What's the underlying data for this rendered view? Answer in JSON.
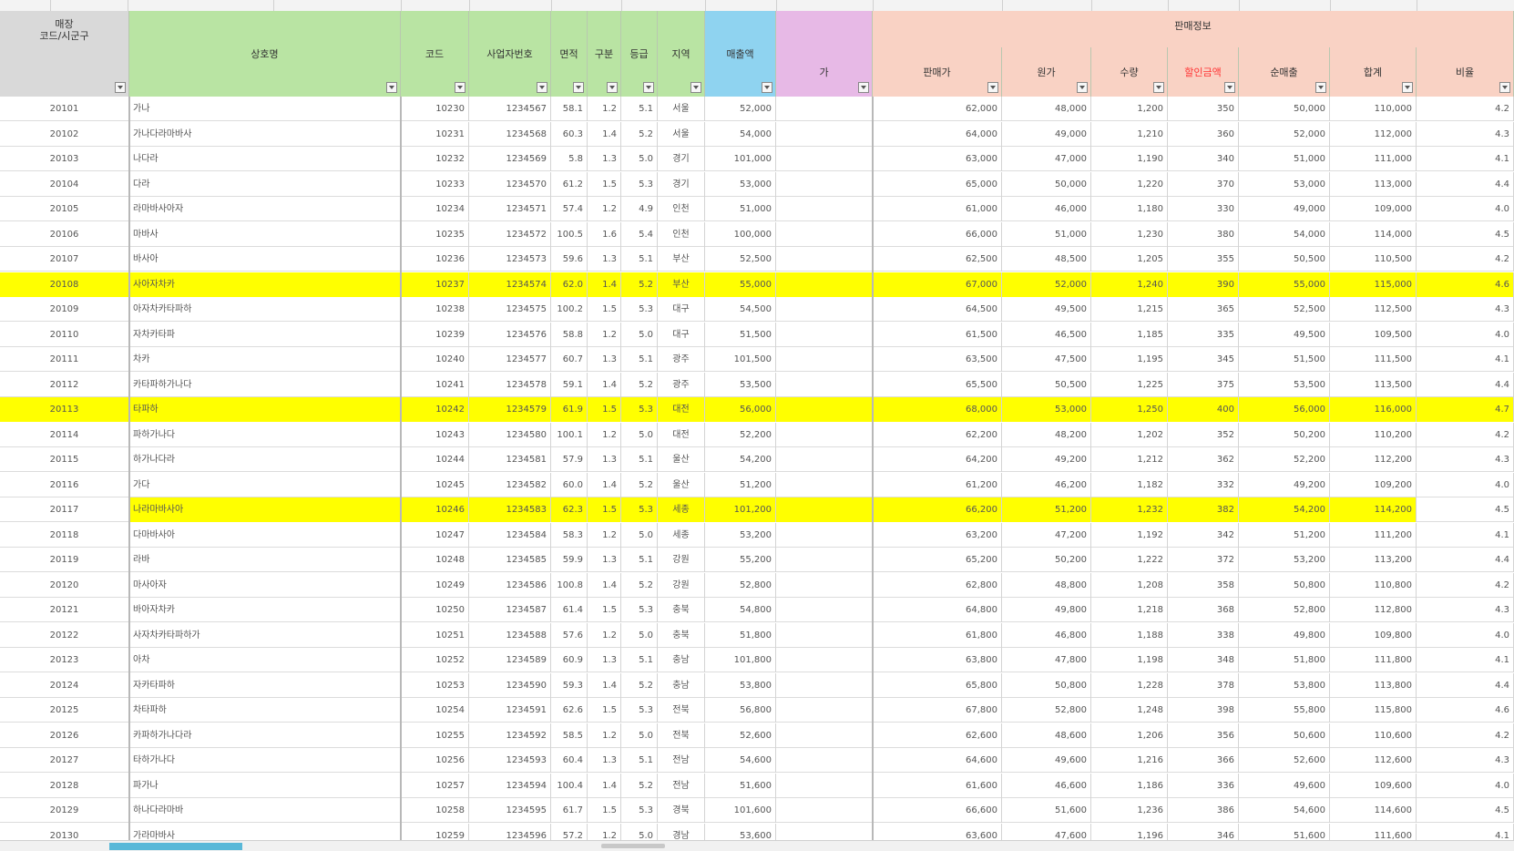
{
  "colors": {
    "green_header": "#b9e4a3",
    "blue_header": "#8fd3f0",
    "pink_header": "#f9d2c4",
    "gray_header": "#d9d9d9",
    "highlight": "#ffff00",
    "red_text": "#ff3333"
  },
  "group_header": {
    "label": "판매정보"
  },
  "columns": [
    {
      "key": "code",
      "label": "매장\n코드/시군구",
      "bg": "gray"
    },
    {
      "key": "name",
      "label": "상호명",
      "bg": "green"
    },
    {
      "key": "c2",
      "label": "코드",
      "bg": "green"
    },
    {
      "key": "c3",
      "label": "사업자번호",
      "bg": "green"
    },
    {
      "key": "c4",
      "label": "면적",
      "bg": "green"
    },
    {
      "key": "c5",
      "label": "구분",
      "bg": "green"
    },
    {
      "key": "c6",
      "label": "등급",
      "bg": "green"
    },
    {
      "key": "c7",
      "label": "지역",
      "bg": "green"
    },
    {
      "key": "c8",
      "label": "매출액",
      "bg": "blue"
    },
    {
      "key": "c9",
      "label": "가",
      "bg": "purple"
    },
    {
      "key": "c10",
      "label": "판매가",
      "bg": "pink"
    },
    {
      "key": "c11",
      "label": "원가",
      "bg": "pink"
    },
    {
      "key": "c12",
      "label": "수량",
      "bg": "pink"
    },
    {
      "key": "c13",
      "label": "할인금액",
      "bg": "pink",
      "red": true
    },
    {
      "key": "c14",
      "label": "순매출",
      "bg": "pink"
    },
    {
      "key": "c15",
      "label": "합계",
      "bg": "pink"
    },
    {
      "key": "c16",
      "label": "비율",
      "bg": "pink"
    }
  ],
  "rows": [
    {
      "cells": [
        "20101",
        "가나",
        "10230",
        "1234567",
        "58.1",
        "1.2",
        "5.1",
        "서울",
        "52,000",
        "",
        "62,000",
        "48,000",
        "1,200",
        "350",
        "50,000",
        "110,000",
        "4.2"
      ]
    },
    {
      "cells": [
        "20102",
        "가나다라마바사",
        "10231",
        "1234568",
        "60.3",
        "1.4",
        "5.2",
        "서울",
        "54,000",
        "",
        "64,000",
        "49,000",
        "1,210",
        "360",
        "52,000",
        "112,000",
        "4.3"
      ]
    },
    {
      "cells": [
        "20103",
        "나다라",
        "10232",
        "1234569",
        "5.8",
        "1.3",
        "5.0",
        "경기",
        "101,000",
        "",
        "63,000",
        "47,000",
        "1,190",
        "340",
        "51,000",
        "111,000",
        "4.1"
      ]
    },
    {
      "cells": [
        "20104",
        "다라",
        "10233",
        "1234570",
        "61.2",
        "1.5",
        "5.3",
        "경기",
        "53,000",
        "",
        "65,000",
        "50,000",
        "1,220",
        "370",
        "53,000",
        "113,000",
        "4.4"
      ]
    },
    {
      "cells": [
        "20105",
        "라마바사아자",
        "10234",
        "1234571",
        "57.4",
        "1.2",
        "4.9",
        "인천",
        "51,000",
        "",
        "61,000",
        "46,000",
        "1,180",
        "330",
        "49,000",
        "109,000",
        "4.0"
      ]
    },
    {
      "cells": [
        "20106",
        "마바사",
        "10235",
        "1234572",
        "100.5",
        "1.6",
        "5.4",
        "인천",
        "100,000",
        "",
        "66,000",
        "51,000",
        "1,230",
        "380",
        "54,000",
        "114,000",
        "4.5"
      ]
    },
    {
      "cells": [
        "20107",
        "바사아",
        "10236",
        "1234573",
        "59.6",
        "1.3",
        "5.1",
        "부산",
        "52,500",
        "",
        "62,500",
        "48,500",
        "1,205",
        "355",
        "50,500",
        "110,500",
        "4.2"
      ]
    },
    {
      "cells": [
        "20108",
        "사아자차카",
        "10237",
        "1234574",
        "62.0",
        "1.4",
        "5.2",
        "부산",
        "55,000",
        "",
        "67,000",
        "52,000",
        "1,240",
        "390",
        "55,000",
        "115,000",
        "4.6"
      ],
      "highlight": "full"
    },
    {
      "cells": [
        "20109",
        "아자차카타파하",
        "10238",
        "1234575",
        "100.2",
        "1.5",
        "5.3",
        "대구",
        "54,500",
        "",
        "64,500",
        "49,500",
        "1,215",
        "365",
        "52,500",
        "112,500",
        "4.3"
      ]
    },
    {
      "cells": [
        "20110",
        "자차카타파",
        "10239",
        "1234576",
        "58.8",
        "1.2",
        "5.0",
        "대구",
        "51,500",
        "",
        "61,500",
        "46,500",
        "1,185",
        "335",
        "49,500",
        "109,500",
        "4.0"
      ]
    },
    {
      "cells": [
        "20111",
        "차카",
        "10240",
        "1234577",
        "60.7",
        "1.3",
        "5.1",
        "광주",
        "101,500",
        "",
        "63,500",
        "47,500",
        "1,195",
        "345",
        "51,500",
        "111,500",
        "4.1"
      ]
    },
    {
      "cells": [
        "20112",
        "카타파하가나다",
        "10241",
        "1234578",
        "59.1",
        "1.4",
        "5.2",
        "광주",
        "53,500",
        "",
        "65,500",
        "50,500",
        "1,225",
        "375",
        "53,500",
        "113,500",
        "4.4"
      ]
    },
    {
      "cells": [
        "20113",
        "타파하",
        "10242",
        "1234579",
        "61.9",
        "1.5",
        "5.3",
        "대전",
        "56,000",
        "",
        "68,000",
        "53,000",
        "1,250",
        "400",
        "56,000",
        "116,000",
        "4.7"
      ],
      "highlight": "full"
    },
    {
      "cells": [
        "20114",
        "파하가나다",
        "10243",
        "1234580",
        "100.1",
        "1.2",
        "5.0",
        "대전",
        "52,200",
        "",
        "62,200",
        "48,200",
        "1,202",
        "352",
        "50,200",
        "110,200",
        "4.2"
      ]
    },
    {
      "cells": [
        "20115",
        "하가나다라",
        "10244",
        "1234581",
        "57.9",
        "1.3",
        "5.1",
        "울산",
        "54,200",
        "",
        "64,200",
        "49,200",
        "1,212",
        "362",
        "52,200",
        "112,200",
        "4.3"
      ]
    },
    {
      "cells": [
        "20116",
        "가다",
        "10245",
        "1234582",
        "60.0",
        "1.4",
        "5.2",
        "울산",
        "51,200",
        "",
        "61,200",
        "46,200",
        "1,182",
        "332",
        "49,200",
        "109,200",
        "4.0"
      ]
    },
    {
      "cells": [
        "20117",
        "나라마바사아",
        "10246",
        "1234583",
        "62.3",
        "1.5",
        "5.3",
        "세종",
        "101,200",
        "",
        "66,200",
        "51,200",
        "1,232",
        "382",
        "54,200",
        "114,200",
        "4.5"
      ],
      "highlight": "partial"
    },
    {
      "cells": [
        "20118",
        "다마바사아",
        "10247",
        "1234584",
        "58.3",
        "1.2",
        "5.0",
        "세종",
        "53,200",
        "",
        "63,200",
        "47,200",
        "1,192",
        "342",
        "51,200",
        "111,200",
        "4.1"
      ]
    },
    {
      "cells": [
        "20119",
        "라바",
        "10248",
        "1234585",
        "59.9",
        "1.3",
        "5.1",
        "강원",
        "55,200",
        "",
        "65,200",
        "50,200",
        "1,222",
        "372",
        "53,200",
        "113,200",
        "4.4"
      ]
    },
    {
      "cells": [
        "20120",
        "마사아자",
        "10249",
        "1234586",
        "100.8",
        "1.4",
        "5.2",
        "강원",
        "52,800",
        "",
        "62,800",
        "48,800",
        "1,208",
        "358",
        "50,800",
        "110,800",
        "4.2"
      ]
    },
    {
      "cells": [
        "20121",
        "바아자차카",
        "10250",
        "1234587",
        "61.4",
        "1.5",
        "5.3",
        "충북",
        "54,800",
        "",
        "64,800",
        "49,800",
        "1,218",
        "368",
        "52,800",
        "112,800",
        "4.3"
      ]
    },
    {
      "cells": [
        "20122",
        "사자차카타파하가",
        "10251",
        "1234588",
        "57.6",
        "1.2",
        "5.0",
        "충북",
        "51,800",
        "",
        "61,800",
        "46,800",
        "1,188",
        "338",
        "49,800",
        "109,800",
        "4.0"
      ]
    },
    {
      "cells": [
        "20123",
        "아차",
        "10252",
        "1234589",
        "60.9",
        "1.3",
        "5.1",
        "충남",
        "101,800",
        "",
        "63,800",
        "47,800",
        "1,198",
        "348",
        "51,800",
        "111,800",
        "4.1"
      ]
    },
    {
      "cells": [
        "20124",
        "자카타파하",
        "10253",
        "1234590",
        "59.3",
        "1.4",
        "5.2",
        "충남",
        "53,800",
        "",
        "65,800",
        "50,800",
        "1,228",
        "378",
        "53,800",
        "113,800",
        "4.4"
      ]
    },
    {
      "cells": [
        "20125",
        "차타파하",
        "10254",
        "1234591",
        "62.6",
        "1.5",
        "5.3",
        "전북",
        "56,800",
        "",
        "67,800",
        "52,800",
        "1,248",
        "398",
        "55,800",
        "115,800",
        "4.6"
      ]
    },
    {
      "cells": [
        "20126",
        "카파하가나다라",
        "10255",
        "1234592",
        "58.5",
        "1.2",
        "5.0",
        "전북",
        "52,600",
        "",
        "62,600",
        "48,600",
        "1,206",
        "356",
        "50,600",
        "110,600",
        "4.2"
      ]
    },
    {
      "cells": [
        "20127",
        "타하가나다",
        "10256",
        "1234593",
        "60.4",
        "1.3",
        "5.1",
        "전남",
        "54,600",
        "",
        "64,600",
        "49,600",
        "1,216",
        "366",
        "52,600",
        "112,600",
        "4.3"
      ]
    },
    {
      "cells": [
        "20128",
        "파가나",
        "10257",
        "1234594",
        "100.4",
        "1.4",
        "5.2",
        "전남",
        "51,600",
        "",
        "61,600",
        "46,600",
        "1,186",
        "336",
        "49,600",
        "109,600",
        "4.0"
      ]
    },
    {
      "cells": [
        "20129",
        "하나다라마바",
        "10258",
        "1234595",
        "61.7",
        "1.5",
        "5.3",
        "경북",
        "101,600",
        "",
        "66,600",
        "51,600",
        "1,236",
        "386",
        "54,600",
        "114,600",
        "4.5"
      ]
    },
    {
      "cells": [
        "20130",
        "가라마바사",
        "10259",
        "1234596",
        "57.2",
        "1.2",
        "5.0",
        "경남",
        "53,600",
        "",
        "63,600",
        "47,600",
        "1,196",
        "346",
        "51,600",
        "111,600",
        "4.1"
      ]
    }
  ]
}
